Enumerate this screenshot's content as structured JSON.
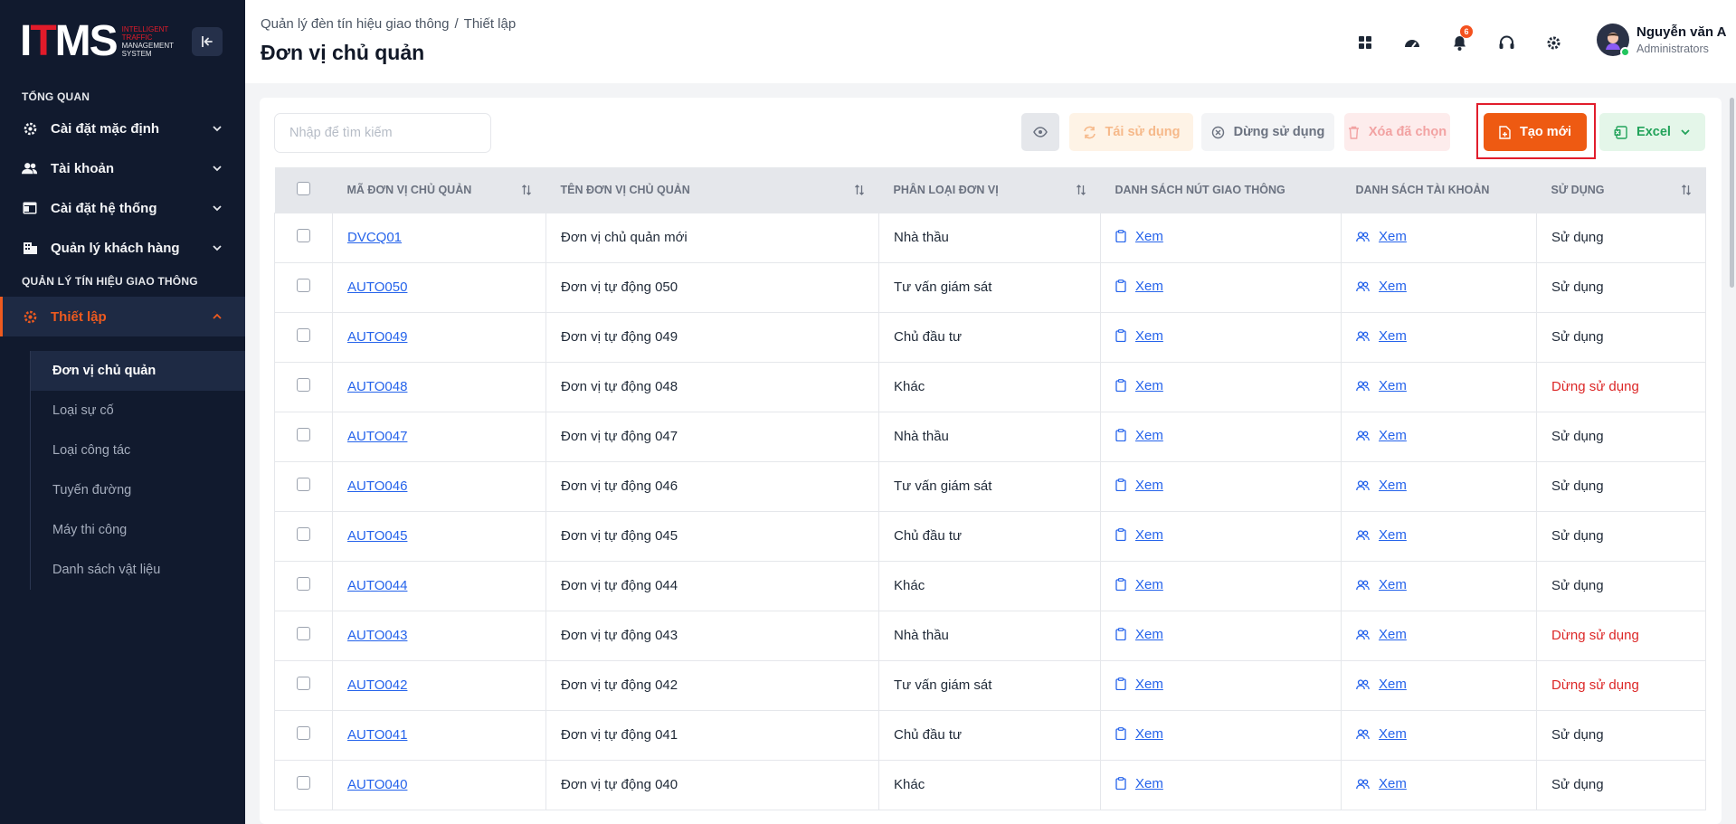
{
  "sidebar": {
    "logo_text": "ITMS",
    "logo_sub": [
      "INTELLIGENT",
      "TRAFFIC",
      "MANAGEMENT",
      "SYSTEM"
    ],
    "section_overview": "TỔNG QUAN",
    "items": [
      {
        "label": "Cài đặt mặc định",
        "icon": "gear-icon"
      },
      {
        "label": "Tài khoản",
        "icon": "users-icon"
      },
      {
        "label": "Cài đặt hệ thống",
        "icon": "window-icon"
      },
      {
        "label": "Quản lý khách hàng",
        "icon": "building-icon"
      }
    ],
    "section_traffic": "QUẢN LÝ TÍN HIỆU GIAO THÔNG",
    "active_item": {
      "label": "Thiết lập",
      "icon": "gear-icon"
    },
    "sub_items": [
      "Đơn vị chủ quản",
      "Loại sự cố",
      "Loại công tác",
      "Tuyến đường",
      "Máy thi công",
      "Danh sách vật liệu"
    ]
  },
  "header": {
    "breadcrumb": [
      "Quản lý đèn tín hiệu giao thông",
      "Thiết lập"
    ],
    "breadcrumb_sep": "/",
    "title": "Đơn vị chủ quản",
    "notification_count": "6",
    "user_name": "Nguyễn văn A",
    "user_role": "Administrators"
  },
  "toolbar": {
    "search_placeholder": "Nhập để tìm kiếm",
    "reuse_label": "Tái sử dụng",
    "stop_label": "Dừng sử dụng",
    "delete_label": "Xóa đã chọn",
    "new_label": "Tạo mới",
    "excel_label": "Excel"
  },
  "table": {
    "columns": [
      "MÃ ĐƠN VỊ CHỦ QUẢN",
      "TÊN ĐƠN VỊ CHỦ QUẢN",
      "PHÂN LOẠI ĐƠN VỊ",
      "DANH SÁCH NÚT GIAO THÔNG",
      "DANH SÁCH TÀI KHOẢN",
      "SỬ DỤNG"
    ],
    "view_label": "Xem",
    "rows": [
      {
        "code": "DVCQ01",
        "name": "Đơn vị chủ quản mới",
        "type": "Nhà thầu",
        "status": "Sử dụng",
        "active": true
      },
      {
        "code": "AUTO050",
        "name": "Đơn vị tự động 050",
        "type": "Tư vấn giám sát",
        "status": "Sử dụng",
        "active": true
      },
      {
        "code": "AUTO049",
        "name": "Đơn vị tự động 049",
        "type": "Chủ đầu tư",
        "status": "Sử dụng",
        "active": true
      },
      {
        "code": "AUTO048",
        "name": "Đơn vị tự động 048",
        "type": "Khác",
        "status": "Dừng sử dụng",
        "active": false
      },
      {
        "code": "AUTO047",
        "name": "Đơn vị tự động 047",
        "type": "Nhà thầu",
        "status": "Sử dụng",
        "active": true
      },
      {
        "code": "AUTO046",
        "name": "Đơn vị tự động 046",
        "type": "Tư vấn giám sát",
        "status": "Sử dụng",
        "active": true
      },
      {
        "code": "AUTO045",
        "name": "Đơn vị tự động 045",
        "type": "Chủ đầu tư",
        "status": "Sử dụng",
        "active": true
      },
      {
        "code": "AUTO044",
        "name": "Đơn vị tự động 044",
        "type": "Khác",
        "status": "Sử dụng",
        "active": true
      },
      {
        "code": "AUTO043",
        "name": "Đơn vị tự động 043",
        "type": "Nhà thầu",
        "status": "Dừng sử dụng",
        "active": false
      },
      {
        "code": "AUTO042",
        "name": "Đơn vị tự động 042",
        "type": "Tư vấn giám sát",
        "status": "Dừng sử dụng",
        "active": false
      },
      {
        "code": "AUTO041",
        "name": "Đơn vị tự động 041",
        "type": "Chủ đầu tư",
        "status": "Sử dụng",
        "active": true
      },
      {
        "code": "AUTO040",
        "name": "Đơn vị tự động 040",
        "type": "Khác",
        "status": "Sử dụng",
        "active": true
      }
    ]
  },
  "colors": {
    "accent": "#ee5a12",
    "sidebar_bg": "#111a2e",
    "link": "#2563eb",
    "danger": "#dc2626",
    "excel": "#22a35a"
  }
}
